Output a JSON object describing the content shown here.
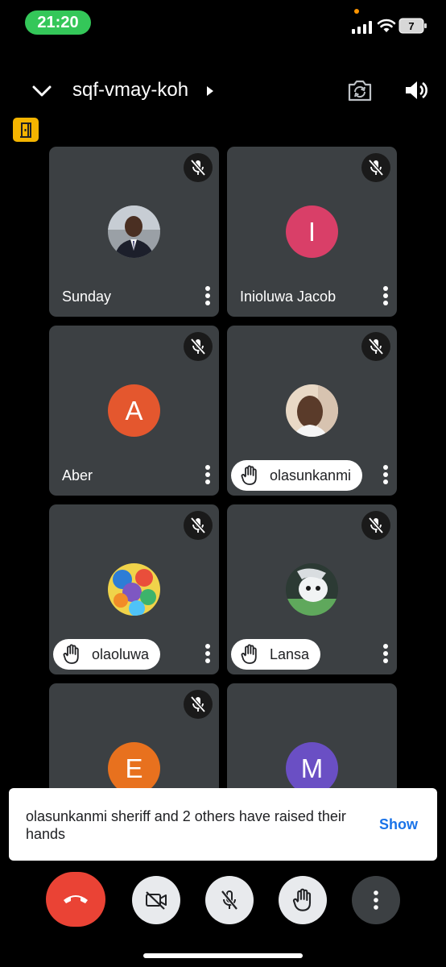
{
  "status_bar": {
    "time": "21:20",
    "battery": "7"
  },
  "header": {
    "meeting_code": "sqf-vmay-koh"
  },
  "participants": [
    {
      "name": "Sunday",
      "avatar_type": "photo",
      "muted": true,
      "hand_raised": false
    },
    {
      "name": "Inioluwa Jacob",
      "avatar_type": "letter",
      "initial": "I",
      "color": "#d93f68",
      "muted": true,
      "hand_raised": false
    },
    {
      "name": "Aber",
      "avatar_type": "letter",
      "initial": "A",
      "color": "#e4572e",
      "muted": true,
      "hand_raised": false
    },
    {
      "name": "olasunkanmi",
      "avatar_type": "photo",
      "muted": true,
      "hand_raised": true
    },
    {
      "name": "olaoluwa",
      "avatar_type": "photo",
      "muted": true,
      "hand_raised": true
    },
    {
      "name": "Lansa",
      "avatar_type": "photo",
      "muted": true,
      "hand_raised": true
    },
    {
      "name": "",
      "avatar_type": "letter",
      "initial": "E",
      "color": "#e8711e",
      "muted": true,
      "hand_raised": false
    },
    {
      "name": "",
      "avatar_type": "letter",
      "initial": "M",
      "color": "#6a4fc4",
      "muted": false,
      "hand_raised": false
    }
  ],
  "toast": {
    "message": "olasunkanmi sheriff and 2 others have raised their hands",
    "action": "Show"
  },
  "controls": [
    "end-call",
    "camera-off",
    "mic-off",
    "raise-hand",
    "more-options"
  ]
}
